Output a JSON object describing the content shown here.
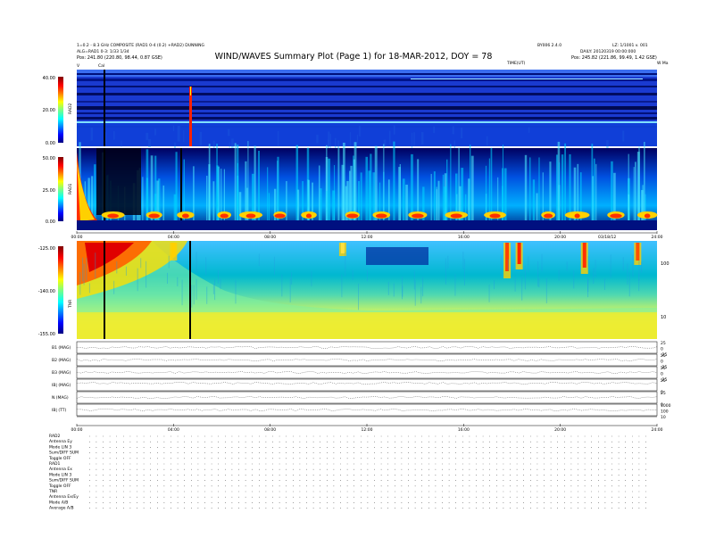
{
  "header": {
    "line1": "1=0.2 - 8.3 GHz COMPOSITE (RAD1 0-4 (0.2) +RAD2) DUNNING",
    "line2": "ALG=RAD1 0-3: 1/33 1/34",
    "line3_left": "Pos:   241.80 (220.80, 98.44, 0.87 GSE)",
    "top_right_a": "BY006 2.4.0",
    "top_right_b": "LZ: 1/1001 v. 001",
    "mid_right": "DAILY: 20120319 00:00:000",
    "right_pos": "Pos:   245.82 (221.86, 99.49, 1.42 GSE)",
    "time_label": "TIME(UT)",
    "left_marker": "V",
    "cal_marker": "Cal",
    "right_marker": "W Ma"
  },
  "title": "WIND/WAVES Summary Plot (Page 1) for 18-MAR-2012, DOY = 78",
  "panels": {
    "rad2": {
      "label": "RAD2",
      "ticks": [
        "40.00",
        "20.00",
        "0.00"
      ]
    },
    "rad1": {
      "label": "RAD1",
      "ticks": [
        "50.00",
        "25.00",
        "0.00"
      ]
    },
    "tnr": {
      "label": "TNR",
      "ticks": [
        "-125.00",
        "-140.00",
        "-155.00"
      ],
      "right_ticks": [
        "100",
        "10"
      ]
    }
  },
  "time_ticks_1": [
    "00:00",
    "04:00",
    "08:00",
    "12:00",
    "16:00",
    "20:00",
    "24:00"
  ],
  "time_ticks_2": [
    "00:00",
    "04:00",
    "08:00",
    "12:00",
    "16:00",
    "20:00",
    "24:00"
  ],
  "day_label": "03/18/12",
  "strips": [
    {
      "label": "B1 (MAG)",
      "right": [
        "25",
        "0",
        "-25"
      ]
    },
    {
      "label": "B2 (MAG)",
      "right": [
        "25",
        "0",
        "-25"
      ]
    },
    {
      "label": "B3 (MAG)",
      "right": [
        "25",
        "0",
        "-25"
      ]
    },
    {
      "label": "IB| (MAG)",
      "right": [
        "25",
        "0"
      ]
    },
    {
      "label": "N (MAG)",
      "right": [
        "25",
        "0"
      ]
    },
    {
      "label": "IB| (TT)",
      "right": [
        "1000",
        "100",
        "10"
      ]
    }
  ],
  "footer": [
    "RAD2",
    "Antenna   Ey",
    "Mode   LIN 3",
    "Sum/DIFF SUM",
    "Toggle   OFF",
    "RAD1",
    "Antenna   Ex",
    "Mode   LIN 3",
    "Sum/DIFF SUM",
    "Toggle   OFF",
    "TNR",
    "Antenna   Ex/Ey",
    "Mode   A/B",
    "Average  A/B"
  ],
  "chart_data": {
    "type": "heatmap",
    "title": "WIND/WAVES Summary Plot (Page 1) for 18-MAR-2012, DOY = 78",
    "x_range_hours": [
      0,
      24
    ],
    "panels": [
      {
        "name": "RAD2",
        "ylim": [
          0,
          40
        ],
        "colormap": "jet"
      },
      {
        "name": "RAD1",
        "ylim": [
          0,
          50
        ],
        "colormap": "jet"
      },
      {
        "name": "TNR",
        "ylim": [
          -155,
          -125
        ],
        "colormap": "jet"
      }
    ],
    "colors": {
      "low": "#00007f",
      "mid": "#00c8ff",
      "high": "#ff0000"
    }
  }
}
